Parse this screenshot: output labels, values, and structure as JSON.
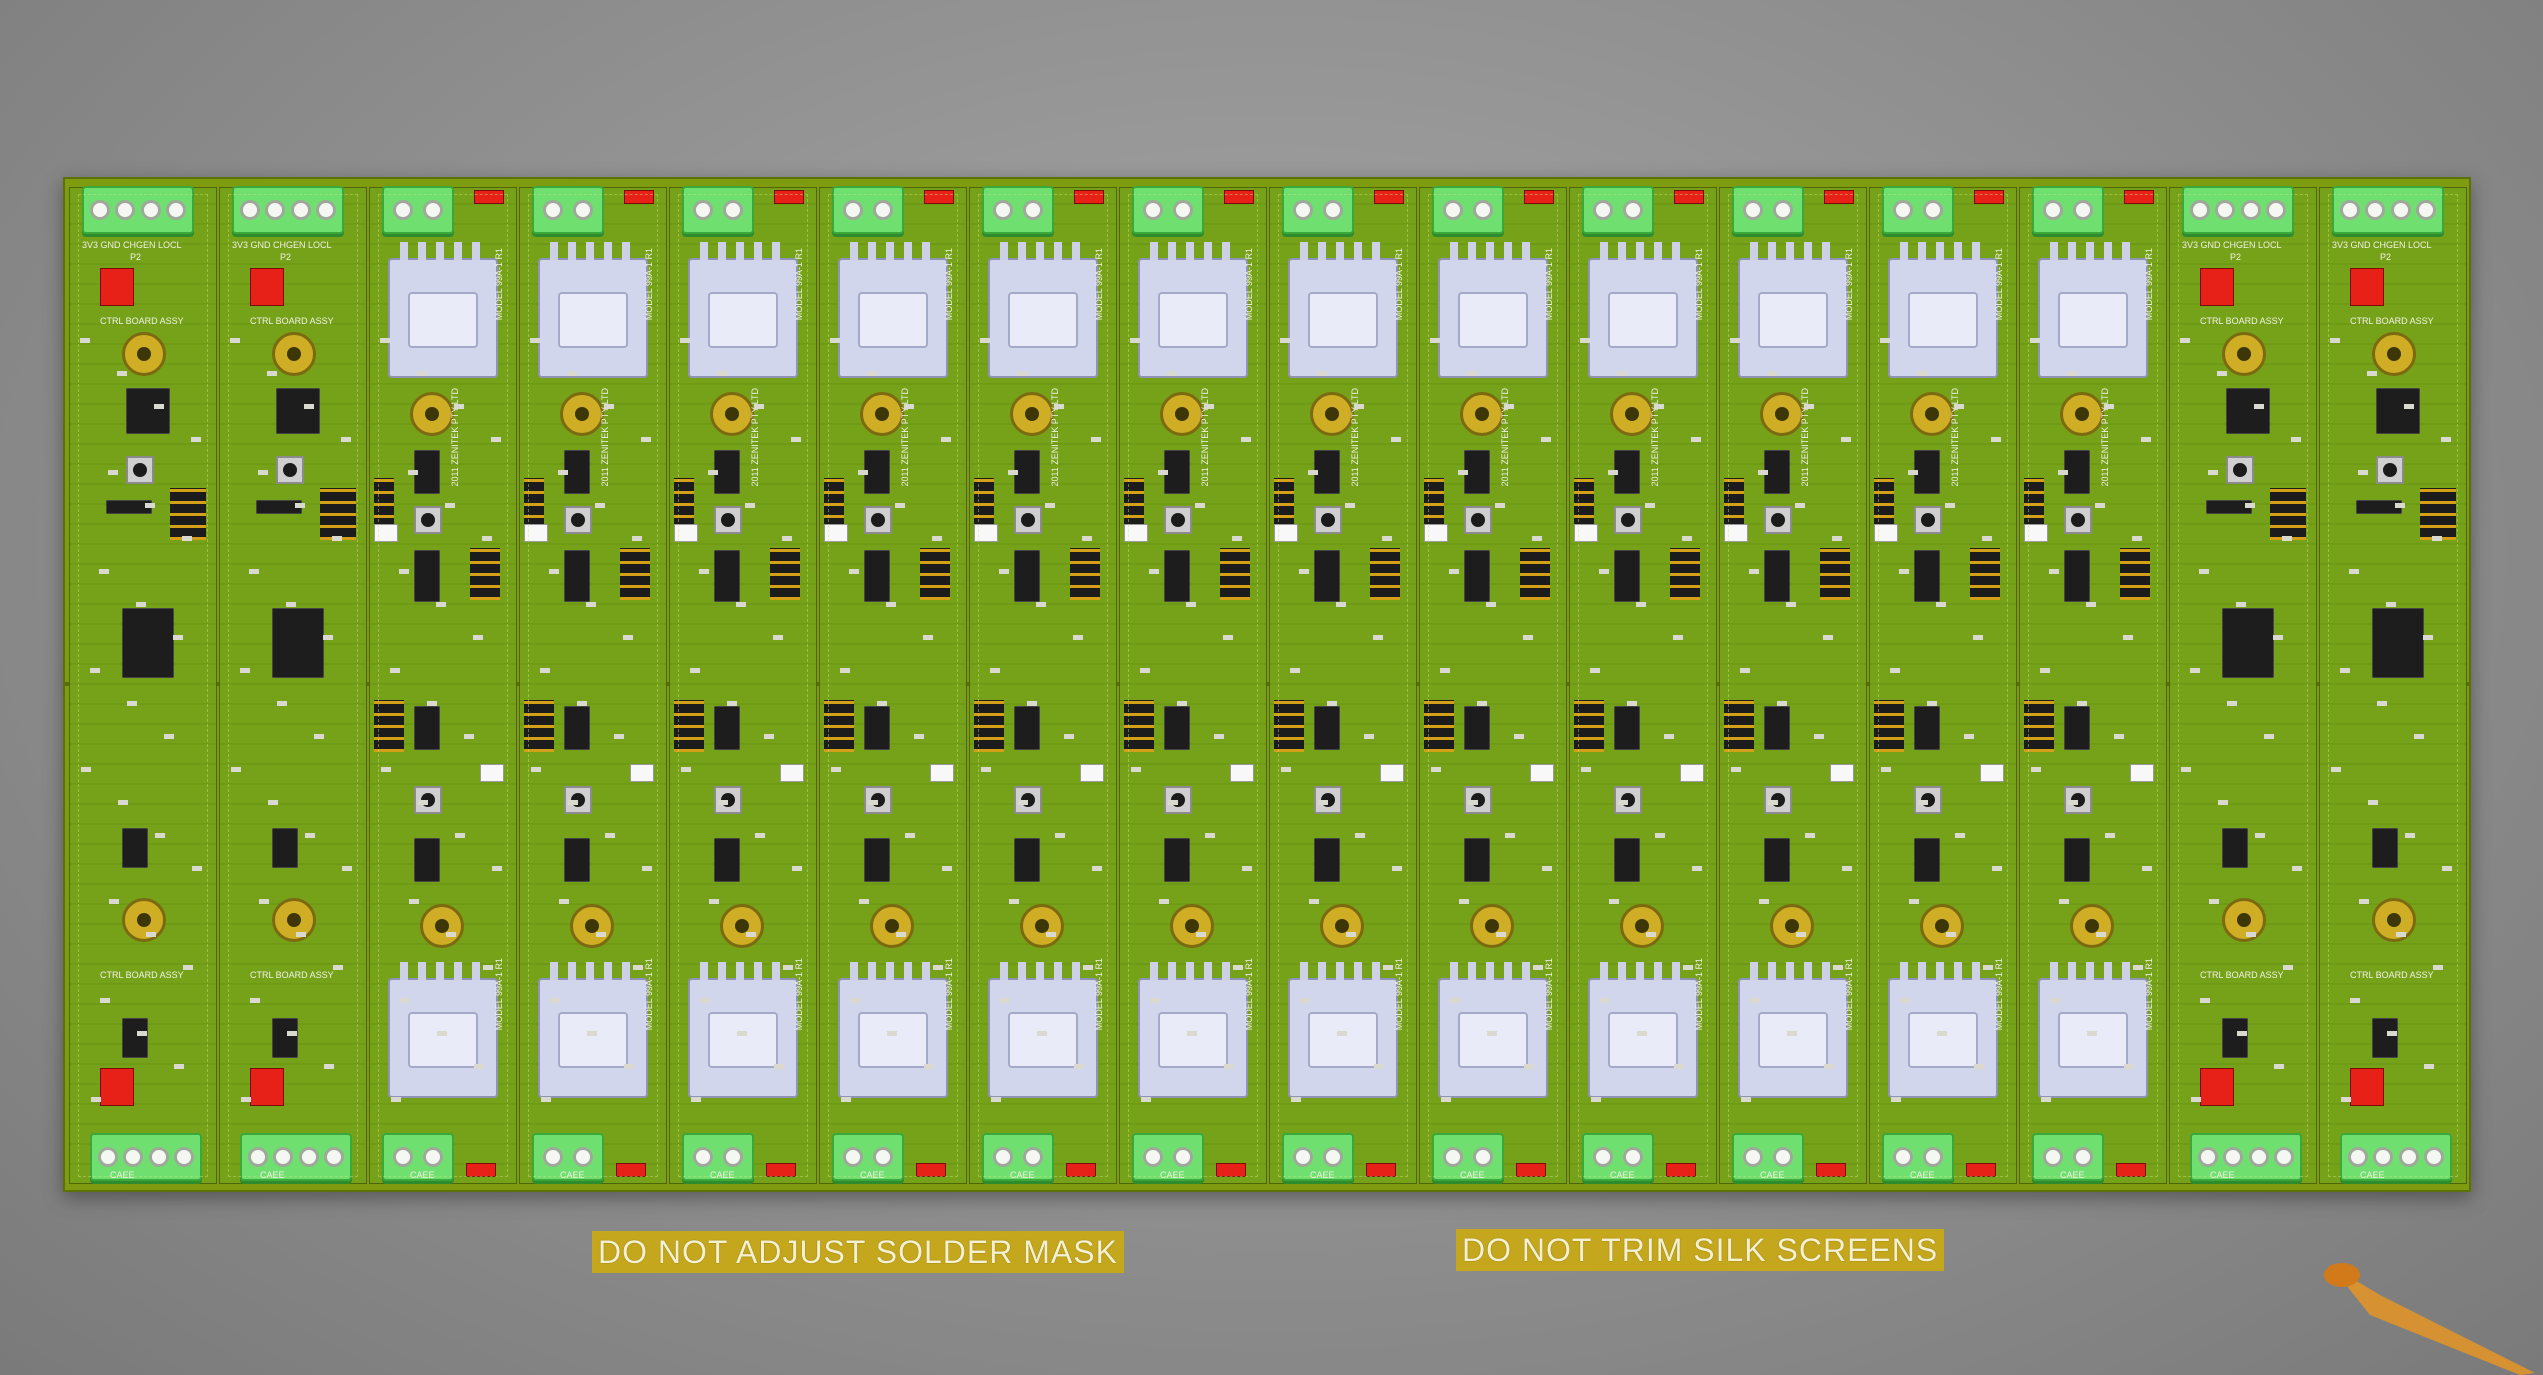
{
  "viewport": {
    "background": "#a3a3a3"
  },
  "panel": {
    "board_color": "#76a21a",
    "board_count": 16
  },
  "silkscreen": {
    "power_board_label": "MODEL 99A-1 R1",
    "ctrl_board_label": "CTRL BOARD ASSY",
    "copyright": "2011 ZENITEK PTY LTD",
    "top_conn_pins": [
      "3V3",
      "GND",
      "CHGEN",
      "LOCL"
    ],
    "header_ref": "P2",
    "edge_text": "CAEE"
  },
  "notes": {
    "solder_mask": "DO NOT ADJUST SOLDER MASK",
    "silk_screens": "DO NOT TRIM SILK SCREENS"
  },
  "colors": {
    "terminal": "#6fe06f",
    "jumper": "#e82118",
    "heatsink": "#d2d6ec",
    "note_strip": "#c4a71c",
    "origin_marker": "#e0932a"
  },
  "icons": {
    "origin": "origin-axis-icon"
  }
}
